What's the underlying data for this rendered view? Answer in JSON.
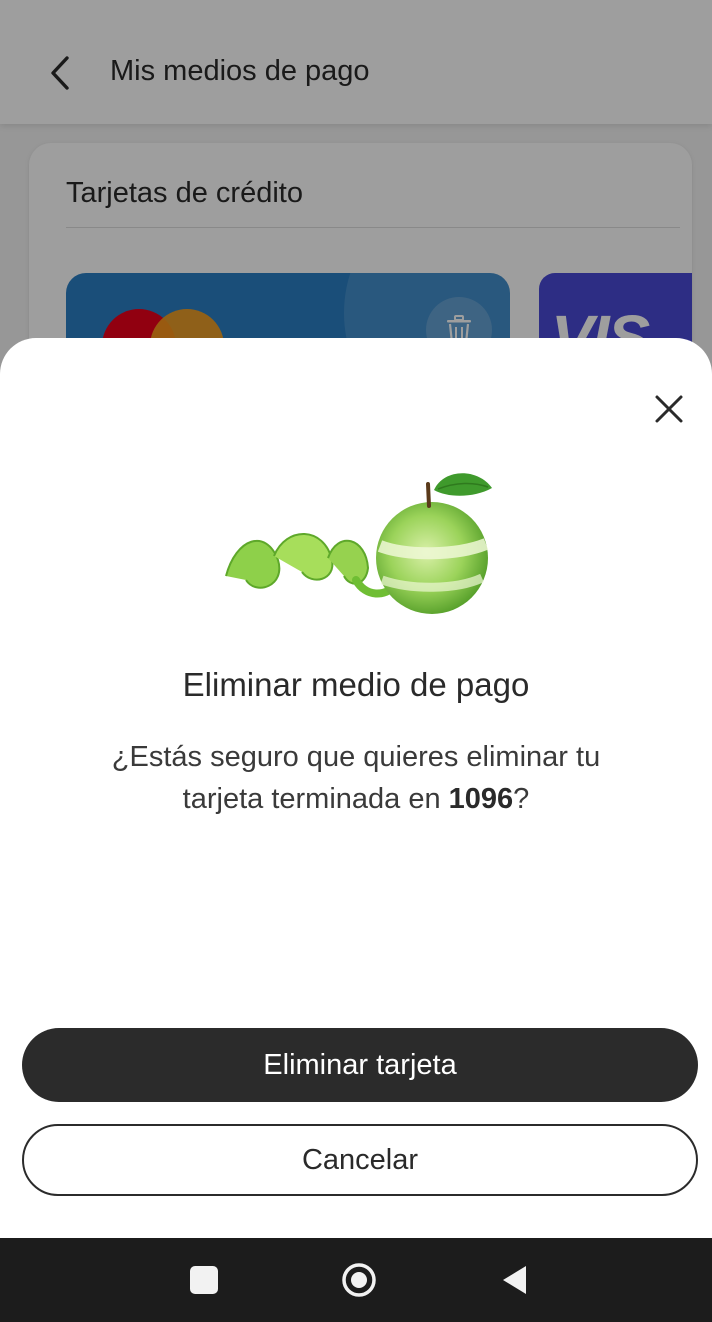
{
  "header": {
    "title": "Mis medios de pago",
    "back_icon": "chevron-left-icon"
  },
  "credit_cards": {
    "section_title": "Tarjetas de crédito",
    "cards": [
      {
        "brand": "mastercard",
        "color": "#2a7fc4",
        "delete_icon": "trash-icon"
      },
      {
        "brand": "visa",
        "color": "#4a4ad6"
      }
    ]
  },
  "dialog": {
    "close_icon": "close-icon",
    "illustration": "peeled-green-apple",
    "title": "Eliminar medio de pago",
    "message_prefix": "¿Estás seguro que quieres eliminar tu tarjeta terminada en ",
    "card_last_digits": "1096",
    "message_suffix": "?",
    "confirm_label": "Eliminar tarjeta",
    "cancel_label": "Cancelar"
  },
  "system_nav": {
    "recent_icon": "square-recents-icon",
    "home_icon": "circle-home-icon",
    "back_icon": "triangle-back-icon"
  },
  "colors": {
    "primary_button": "#2b2b2b",
    "card_blue": "#2a7fc4",
    "card_purple": "#4a4ad6",
    "overlay": "rgba(0,0,0,0.38)"
  }
}
